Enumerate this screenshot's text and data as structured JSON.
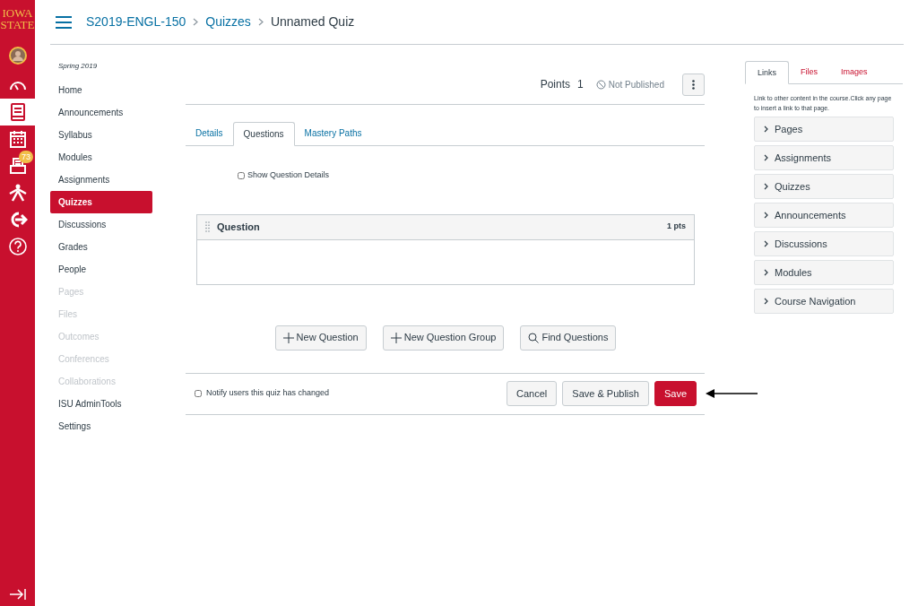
{
  "logo": {
    "line_1": "IOWA",
    "line_2": "STATE"
  },
  "global_nav": [
    {
      "kind": "avatar",
      "selected": false
    },
    {
      "kind": "dashboard",
      "selected": false
    },
    {
      "kind": "courses",
      "selected": true
    },
    {
      "kind": "calendar",
      "selected": false
    },
    {
      "kind": "inbox",
      "selected": false,
      "badge": "73"
    },
    {
      "kind": "commons",
      "selected": false
    },
    {
      "kind": "logout",
      "selected": false
    },
    {
      "kind": "help",
      "selected": false
    }
  ],
  "breadcrumbs": [
    "S2019-ENGL-150",
    "Quizzes",
    "Unnamed Quiz"
  ],
  "course_nav": {
    "term": "Spring 2019",
    "items": [
      {
        "label": "Home",
        "selected": false,
        "disabled": false
      },
      {
        "label": "Announcements",
        "selected": false,
        "disabled": false
      },
      {
        "label": "Syllabus",
        "selected": false,
        "disabled": false
      },
      {
        "label": "Modules",
        "selected": false,
        "disabled": false
      },
      {
        "label": "Assignments",
        "selected": false,
        "disabled": false
      },
      {
        "label": "Quizzes",
        "selected": true,
        "disabled": false
      },
      {
        "label": "Discussions",
        "selected": false,
        "disabled": false
      },
      {
        "label": "Grades",
        "selected": false,
        "disabled": false
      },
      {
        "label": "People",
        "selected": false,
        "disabled": false
      },
      {
        "label": "Pages",
        "selected": false,
        "disabled": true
      },
      {
        "label": "Files",
        "selected": false,
        "disabled": true
      },
      {
        "label": "Outcomes",
        "selected": false,
        "disabled": true
      },
      {
        "label": "Conferences",
        "selected": false,
        "disabled": true
      },
      {
        "label": "Collaborations",
        "selected": false,
        "disabled": true
      },
      {
        "label": "ISU AdminTools",
        "selected": false,
        "disabled": false
      },
      {
        "label": "Settings",
        "selected": false,
        "disabled": false
      }
    ]
  },
  "quiz_header": {
    "points_label": "Points",
    "points_value": "1",
    "status": "Not Published"
  },
  "tabs": [
    {
      "label": "Details",
      "selected": false
    },
    {
      "label": "Questions",
      "selected": true
    },
    {
      "label": "Mastery Paths",
      "selected": false
    }
  ],
  "show_question_details": {
    "label": "Show Question Details",
    "checked": false
  },
  "question": {
    "title": "Question",
    "points": "1 pts"
  },
  "actions": [
    {
      "label": "New Question",
      "kind": "add"
    },
    {
      "label": "New Question Group",
      "kind": "add"
    },
    {
      "label": "Find Questions",
      "kind": "find"
    }
  ],
  "notify": {
    "label": "Notify users this quiz has changed",
    "checked": false
  },
  "footer_buttons": [
    {
      "label": "Cancel",
      "kind": "default"
    },
    {
      "label": "Save & Publish",
      "kind": "default"
    },
    {
      "label": "Save",
      "kind": "primary"
    }
  ],
  "sidebar": {
    "tabs": [
      {
        "label": "Links",
        "selected": true
      },
      {
        "label": "Files",
        "selected": false
      },
      {
        "label": "Images",
        "selected": false
      }
    ],
    "hint": "Link to other content in the course.Click any page to insert a link to that page.",
    "sections": [
      "Pages",
      "Assignments",
      "Quizzes",
      "Announcements",
      "Discussions",
      "Modules",
      "Course Navigation"
    ]
  }
}
